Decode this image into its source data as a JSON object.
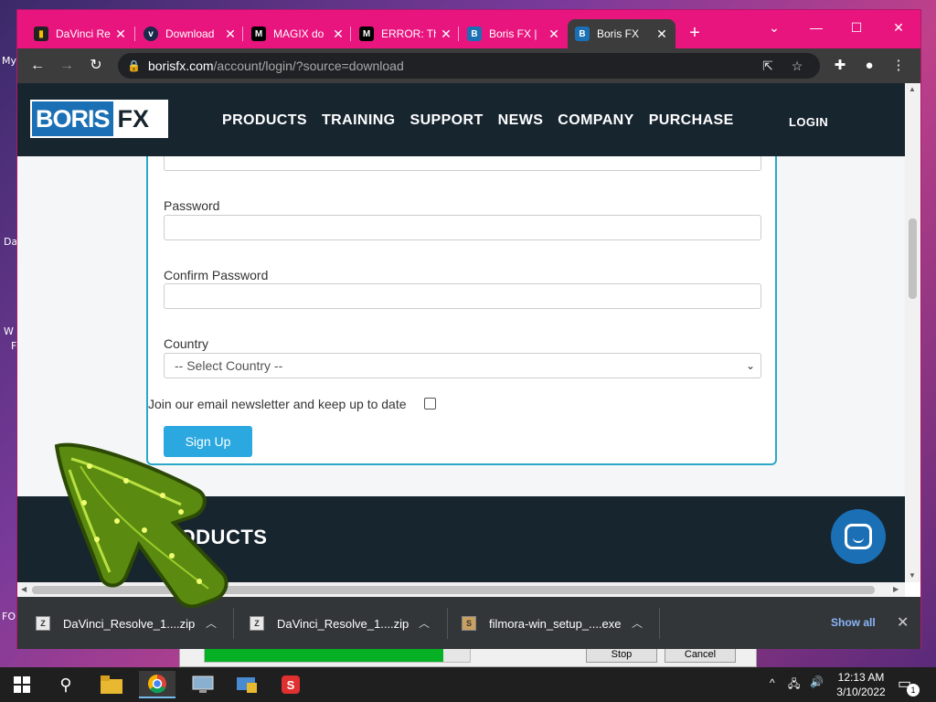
{
  "desktop": {
    "labels": [
      "My",
      "Da",
      "W",
      "F",
      "FO"
    ]
  },
  "bg_dialog": {
    "stop_label": "Stop",
    "cancel_label": "Cancel",
    "progress_fraction": 0.9
  },
  "tabs": [
    {
      "title": "DaVinci Re",
      "favicon": "davinci-icon",
      "active": false
    },
    {
      "title": "Download",
      "favicon": "vimeo-icon",
      "active": false
    },
    {
      "title": "MAGIX do",
      "favicon": "magix-icon",
      "active": false
    },
    {
      "title": "ERROR: Th",
      "favicon": "magix-icon",
      "active": false
    },
    {
      "title": "Boris FX |",
      "favicon": "borisfx-icon",
      "active": false
    },
    {
      "title": "Boris FX",
      "favicon": "borisfx-icon",
      "active": true
    }
  ],
  "address_bar": {
    "host": "borisfx.com",
    "path": "/account/login/?source=download"
  },
  "site": {
    "logo_boris": "BORIS",
    "logo_fx": "FX",
    "nav": [
      "PRODUCTS",
      "TRAINING",
      "SUPPORT",
      "NEWS",
      "COMPANY",
      "PURCHASE"
    ],
    "login": "LOGIN"
  },
  "form": {
    "password_label": "Password",
    "confirm_password_label": "Confirm Password",
    "country_label": "Country",
    "country_selected": "-- Select Country --",
    "newsletter_label": "Join our email newsletter and keep up to date",
    "newsletter_checked": false,
    "signup_label": "Sign Up"
  },
  "footer": {
    "heading": "PRODUCTS"
  },
  "downloads": {
    "items": [
      {
        "name": "DaVinci_Resolve_1....zip"
      },
      {
        "name": "DaVinci_Resolve_1....zip"
      },
      {
        "name": "filmora-win_setup_....exe"
      }
    ],
    "show_all": "Show all"
  },
  "taskbar": {
    "time": "12:13 AM",
    "date": "3/10/2022",
    "notification_count": "1"
  },
  "colors": {
    "titlebar": "#e8157f",
    "site_dark": "#17252f",
    "accent": "#2ba8e0",
    "form_border": "#2aa8c6"
  }
}
